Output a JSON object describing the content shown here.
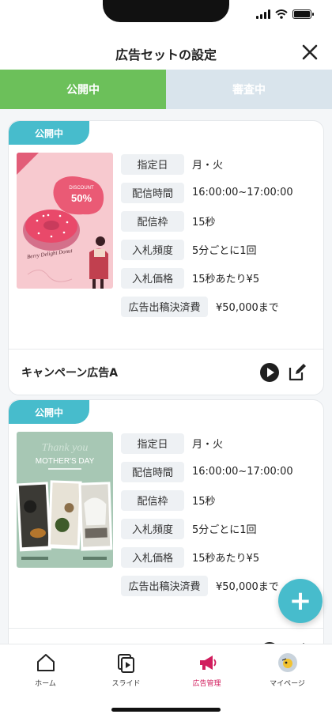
{
  "header": {
    "title": "広告セットの設定"
  },
  "tabs": [
    {
      "label": "公開中",
      "active": true
    },
    {
      "label": "審査中",
      "active": false
    }
  ],
  "cards": [
    {
      "status": "公開中",
      "thumbnail": {
        "promo": "50%",
        "caption": "Berry Delight Donut"
      },
      "details": [
        {
          "label": "指定日",
          "value": "月・火"
        },
        {
          "label": "配信時間",
          "value": "16:00:00~17:00:00"
        },
        {
          "label": "配信枠",
          "value": "15秒"
        },
        {
          "label": "入札頻度",
          "value": "5分ごとに1回"
        },
        {
          "label": "入札価格",
          "value": "15秒あたり¥5"
        }
      ],
      "fee": {
        "label": "広告出稿決済費",
        "value": "¥50,000まで"
      },
      "name": "キャンペーン広告A"
    },
    {
      "status": "公開中",
      "thumbnail": {
        "title": "MOTHER'S DAY",
        "script": "Thank you"
      },
      "details": [
        {
          "label": "指定日",
          "value": "月・火"
        },
        {
          "label": "配信時間",
          "value": "16:00:00~17:00:00"
        },
        {
          "label": "配信枠",
          "value": "15秒"
        },
        {
          "label": "入札頻度",
          "value": "5分ごとに1回"
        },
        {
          "label": "入札価格",
          "value": "15秒あたり¥5"
        }
      ],
      "fee": {
        "label": "広告出稿決済費",
        "value": "¥50,000まで"
      },
      "name": ""
    }
  ],
  "fab": {
    "icon": "plus-icon",
    "symbol": "+"
  },
  "nav": [
    {
      "label": "ホーム",
      "icon": "home-icon",
      "active": false
    },
    {
      "label": "スライド",
      "icon": "slides-icon",
      "active": false
    },
    {
      "label": "広告管理",
      "icon": "megaphone-icon",
      "active": true
    },
    {
      "label": "マイページ",
      "icon": "avatar-icon",
      "active": false
    }
  ],
  "colors": {
    "accent": "#47bccc",
    "tab_active": "#6cc05a",
    "tab_inactive": "#d9e4ec",
    "nav_active": "#d11d5d"
  }
}
